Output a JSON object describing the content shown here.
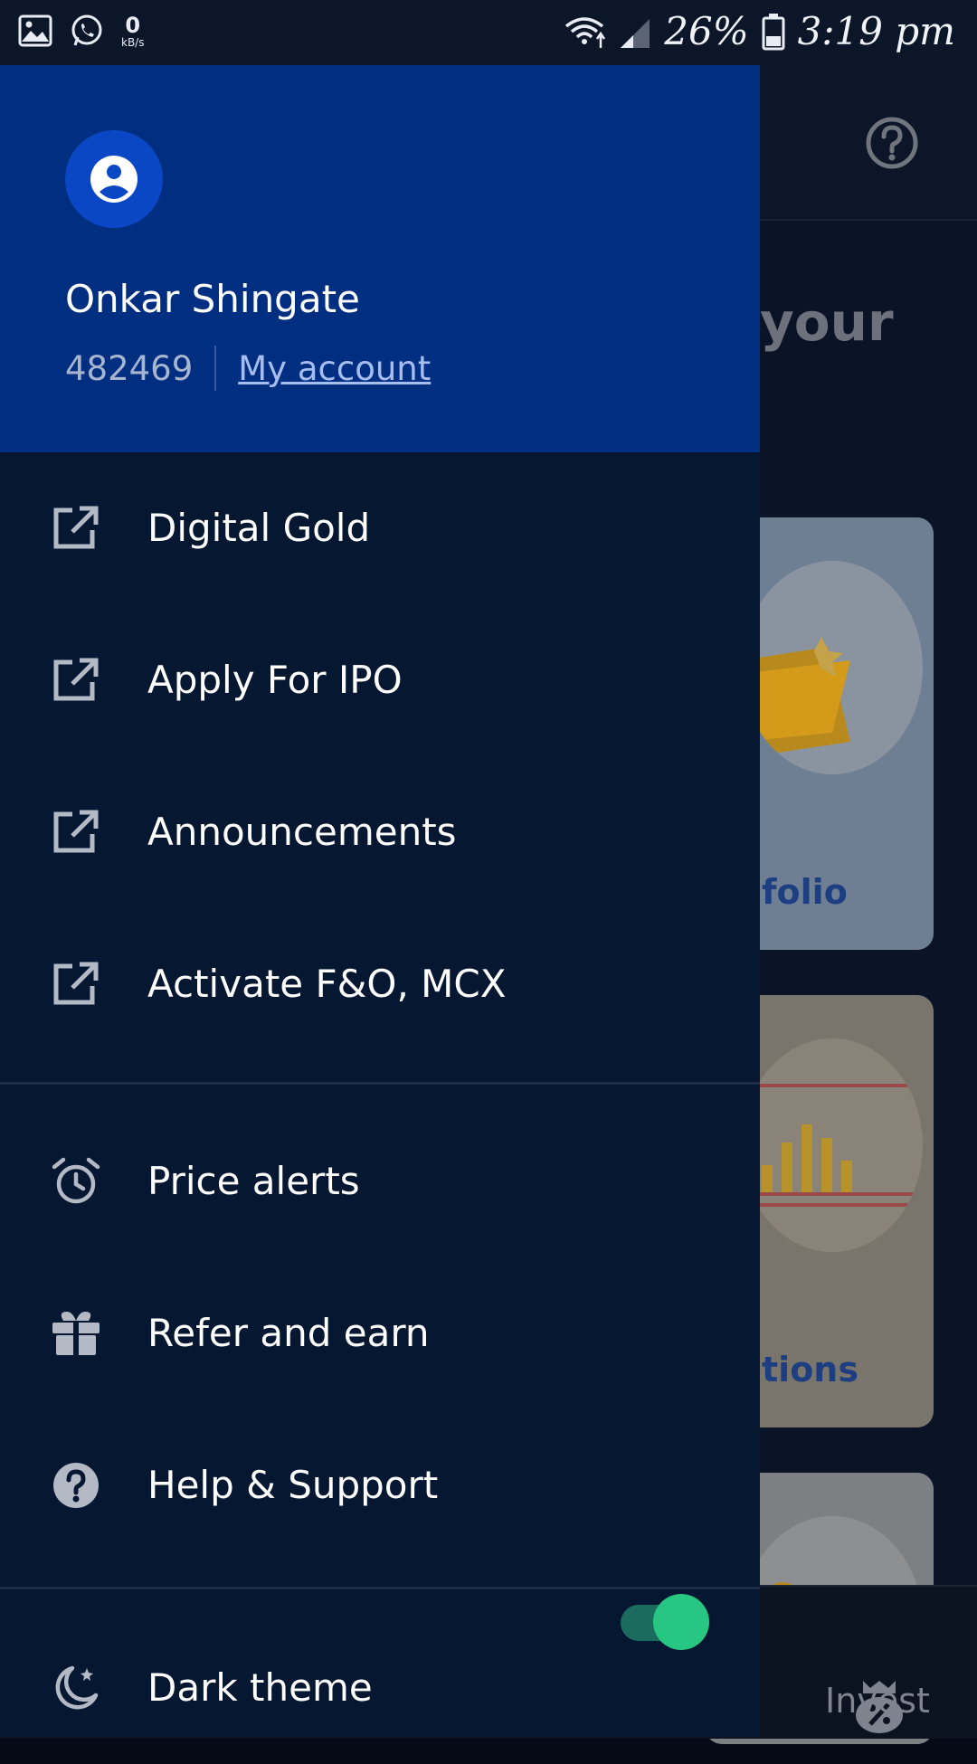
{
  "status_bar": {
    "speed_value": "0",
    "speed_unit": "kB/s",
    "battery_percent": "26%",
    "time": "3:19 pm"
  },
  "background": {
    "heading_fragment": "your",
    "card1_label_fragment": "folio",
    "card2_label_fragment": "tions",
    "bottom_nav_label": "Invest"
  },
  "drawer": {
    "user_name": "Onkar Shingate",
    "user_id": "482469",
    "my_account_link": "My account",
    "external_items": [
      {
        "label": "Digital Gold",
        "icon": "open-in-new-icon"
      },
      {
        "label": "Apply For IPO",
        "icon": "open-in-new-icon"
      },
      {
        "label": "Announcements",
        "icon": "open-in-new-icon"
      },
      {
        "label": "Activate F&O, MCX",
        "icon": "open-in-new-icon"
      }
    ],
    "items": [
      {
        "label": "Price alerts",
        "icon": "alarm-clock-icon"
      },
      {
        "label": "Refer and earn",
        "icon": "gift-icon"
      },
      {
        "label": "Help & Support",
        "icon": "help-circle-icon"
      }
    ],
    "dark_theme_label": "Dark theme",
    "dark_theme_on": true
  },
  "colors": {
    "drawer_header": "#002f82",
    "drawer_body": "#061731",
    "toggle_on": "#27c783"
  }
}
